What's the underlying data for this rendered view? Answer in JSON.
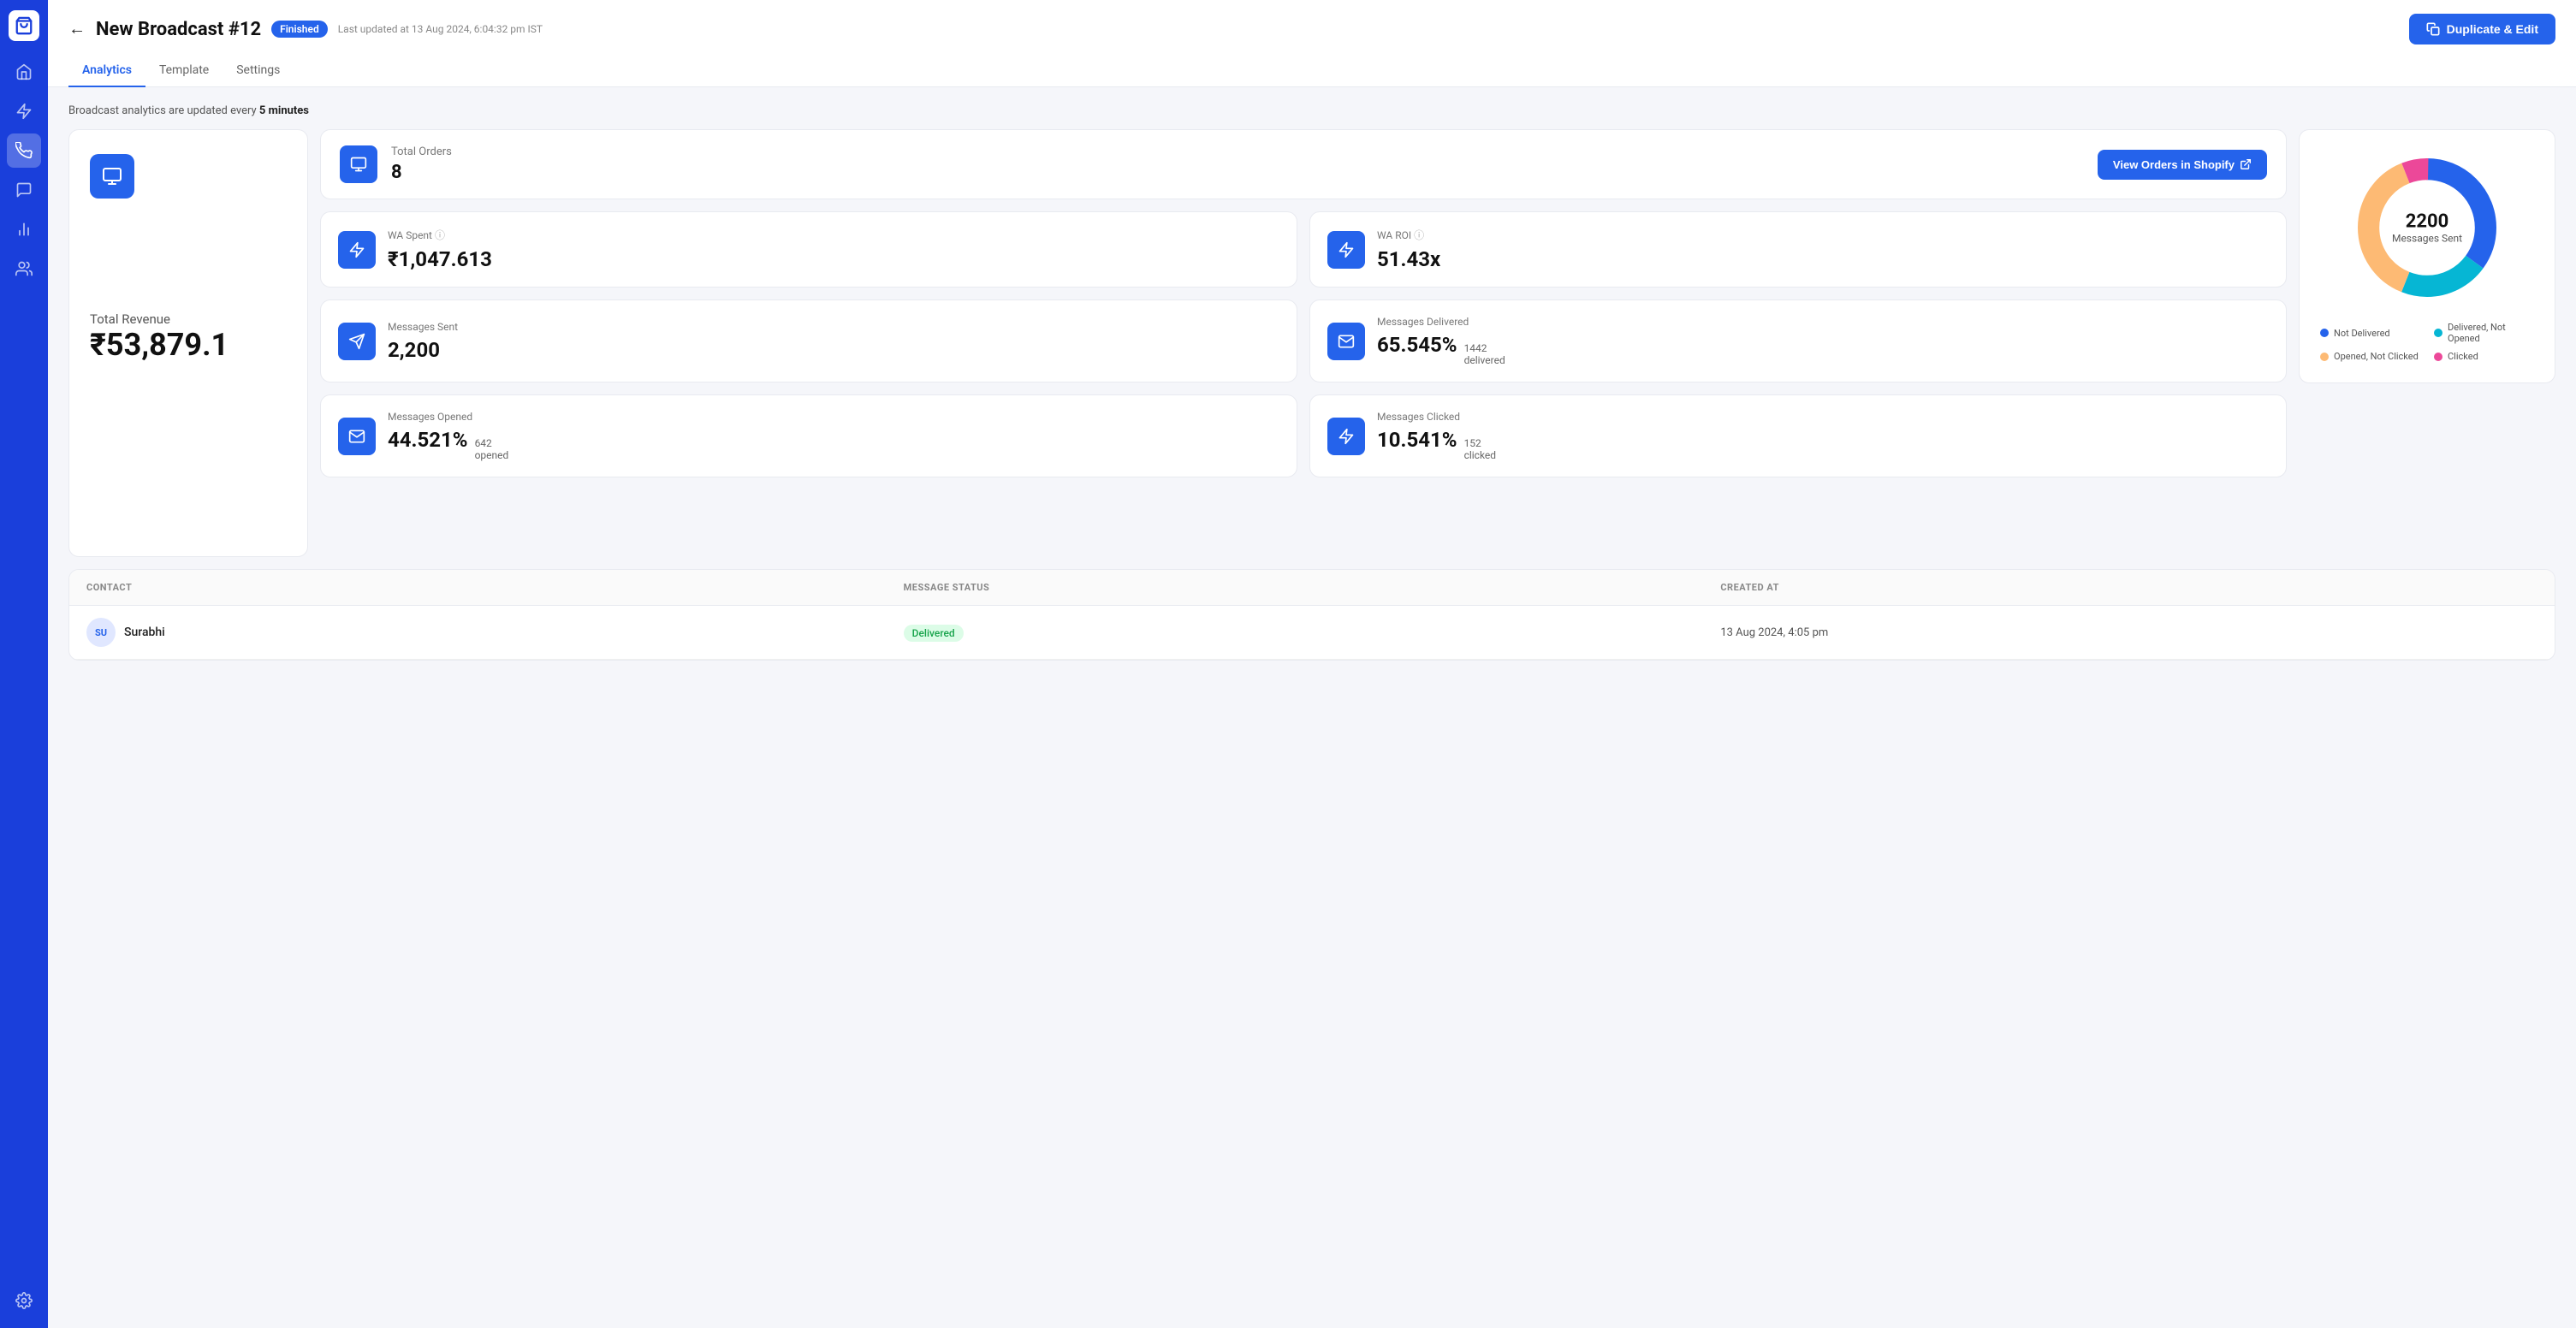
{
  "sidebar": {
    "logo": "🛍",
    "items": [
      {
        "name": "home",
        "icon": "🏠",
        "active": false
      },
      {
        "name": "lightning",
        "icon": "⚡",
        "active": false
      },
      {
        "name": "broadcast",
        "icon": "📢",
        "active": true
      },
      {
        "name": "chat",
        "icon": "💬",
        "active": false
      },
      {
        "name": "analytics",
        "icon": "📊",
        "active": false
      },
      {
        "name": "users",
        "icon": "👥",
        "active": false
      },
      {
        "name": "settings",
        "icon": "⚙️",
        "active": false
      }
    ]
  },
  "header": {
    "back_label": "←",
    "title": "New Broadcast #12",
    "status": "Finished",
    "last_updated": "Last updated at 13 Aug 2024, 6:04:32 pm IST",
    "duplicate_btn": "Duplicate & Edit"
  },
  "tabs": [
    {
      "label": "Analytics",
      "active": true
    },
    {
      "label": "Template",
      "active": false
    },
    {
      "label": "Settings",
      "active": false
    }
  ],
  "analytics_notice": {
    "prefix": "Broadcast analytics are updated every",
    "interval": "5 minutes"
  },
  "revenue": {
    "label": "Total Revenue",
    "value": "₹53,879.1"
  },
  "orders": {
    "label": "Total Orders",
    "value": "8",
    "shopify_btn": "View Orders in Shopify"
  },
  "wa_spent": {
    "label": "WA Spent",
    "value": "₹1,047.613"
  },
  "wa_roi": {
    "label": "WA ROI",
    "value": "51.43x"
  },
  "messages_sent": {
    "label": "Messages Sent",
    "value": "2,200"
  },
  "messages_delivered": {
    "label": "Messages Delivered",
    "percent": "65.545%",
    "count": "1442",
    "unit": "delivered"
  },
  "messages_opened": {
    "label": "Messages Opened",
    "percent": "44.521%",
    "count": "642",
    "unit": "opened"
  },
  "messages_clicked": {
    "label": "Messages Clicked",
    "percent": "10.541%",
    "count": "152",
    "unit": "clicked"
  },
  "donut": {
    "center_count": "2200",
    "center_label": "Messages Sent",
    "segments": [
      {
        "label": "Not Delivered",
        "color": "#2563eb",
        "value": 35,
        "startAngle": 0
      },
      {
        "label": "Delivered, Not Opened",
        "color": "#06b6d4",
        "value": 21,
        "startAngle": 126
      },
      {
        "label": "Opened, Not Clicked",
        "color": "#fdba74",
        "value": 38,
        "startAngle": 202
      },
      {
        "label": "Clicked",
        "color": "#ec4899",
        "value": 6,
        "startAngle": 339
      }
    ]
  },
  "table": {
    "headers": [
      "Contact",
      "MESSAGE STATUS",
      "CREATED AT"
    ],
    "rows": [
      {
        "initials": "SU",
        "name": "Surabhi",
        "status": "Delivered",
        "status_type": "delivered",
        "created_at": "13 Aug 2024, 4:05 pm"
      }
    ]
  }
}
